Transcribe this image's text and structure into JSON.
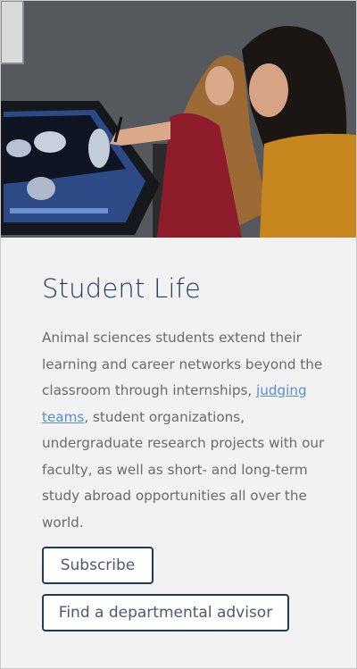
{
  "hero": {
    "alt": "Two students viewing 3D scans on a touchscreen monitor",
    "palette": {
      "wall": "#5c5f63",
      "monitor": "#1a1d22",
      "screen": "#3a5b9a",
      "shirt_red": "#8e1c2a",
      "shirt_gold": "#c8861f",
      "hair_blonde": "#a8743c",
      "hair_dark": "#1b1613",
      "skin": "#d9a98a"
    }
  },
  "section": {
    "title": "Student Life",
    "body_before_link": "Animal sciences students extend their learning and career networks beyond the classroom through internships, ",
    "link_text": "judging teams",
    "body_after_link": ", student organizations, undergraduate research projects with our faculty, as well as short- and long-term study abroad opportunities all over the world."
  },
  "buttons": {
    "subscribe": "Subscribe",
    "advisor": "Find a departmental advisor"
  },
  "colors": {
    "title": "#1f3a5f",
    "body": "#6a6a6a",
    "link": "#5b8ec9",
    "button_border": "#1f3a5f",
    "card_bg": "#f2f2f2"
  }
}
